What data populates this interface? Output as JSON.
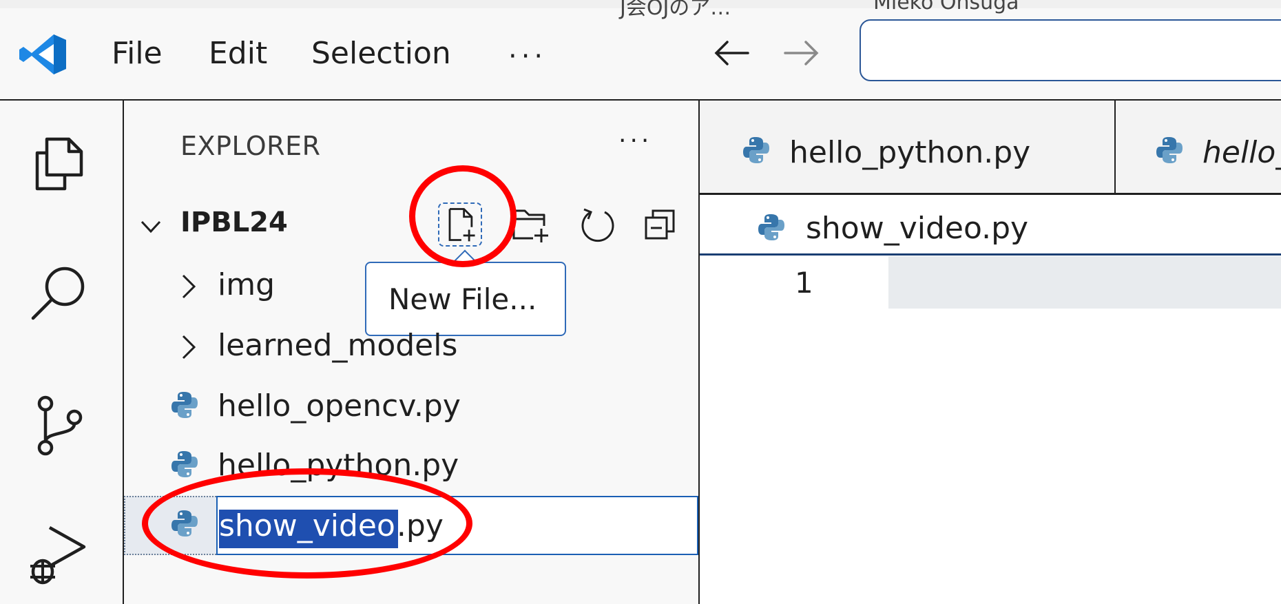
{
  "titlebar": {
    "ghost_left_text": "J会OJのア…",
    "ghost_right_text": "Mieko Ohsuga",
    "menu": [
      "File",
      "Edit",
      "Selection",
      "···"
    ]
  },
  "sidebar": {
    "title": "EXPLORER",
    "more": "···",
    "folder_name": "IPBL24",
    "tooltip": "New File...",
    "items": [
      {
        "label": "img",
        "kind": "folder"
      },
      {
        "label": "learned_models",
        "kind": "folder"
      },
      {
        "label": "hello_opencv.py",
        "kind": "python"
      },
      {
        "label": "hello_python.py",
        "kind": "python"
      }
    ],
    "rename": {
      "selected": "show_video",
      "extension": ".py"
    }
  },
  "editor": {
    "tabs": [
      {
        "label": "hello_python.py"
      },
      {
        "label": "hello_"
      }
    ],
    "breadcrumb": "show_video.py",
    "line_number": "1"
  },
  "colors": {
    "accent": "#2f6ab8",
    "selection": "#1f4fb0",
    "annotation_red": "#ff0000",
    "python_blue": "#3776ab",
    "python_yellow": "#ffd43b"
  },
  "icons": {
    "logo": "vscode-logo-icon",
    "activity": [
      "explorer-icon",
      "search-icon",
      "source-control-icon",
      "run-debug-icon"
    ],
    "folder_toolbar": [
      "new-file-icon",
      "new-folder-icon",
      "refresh-icon",
      "collapse-icon"
    ]
  }
}
